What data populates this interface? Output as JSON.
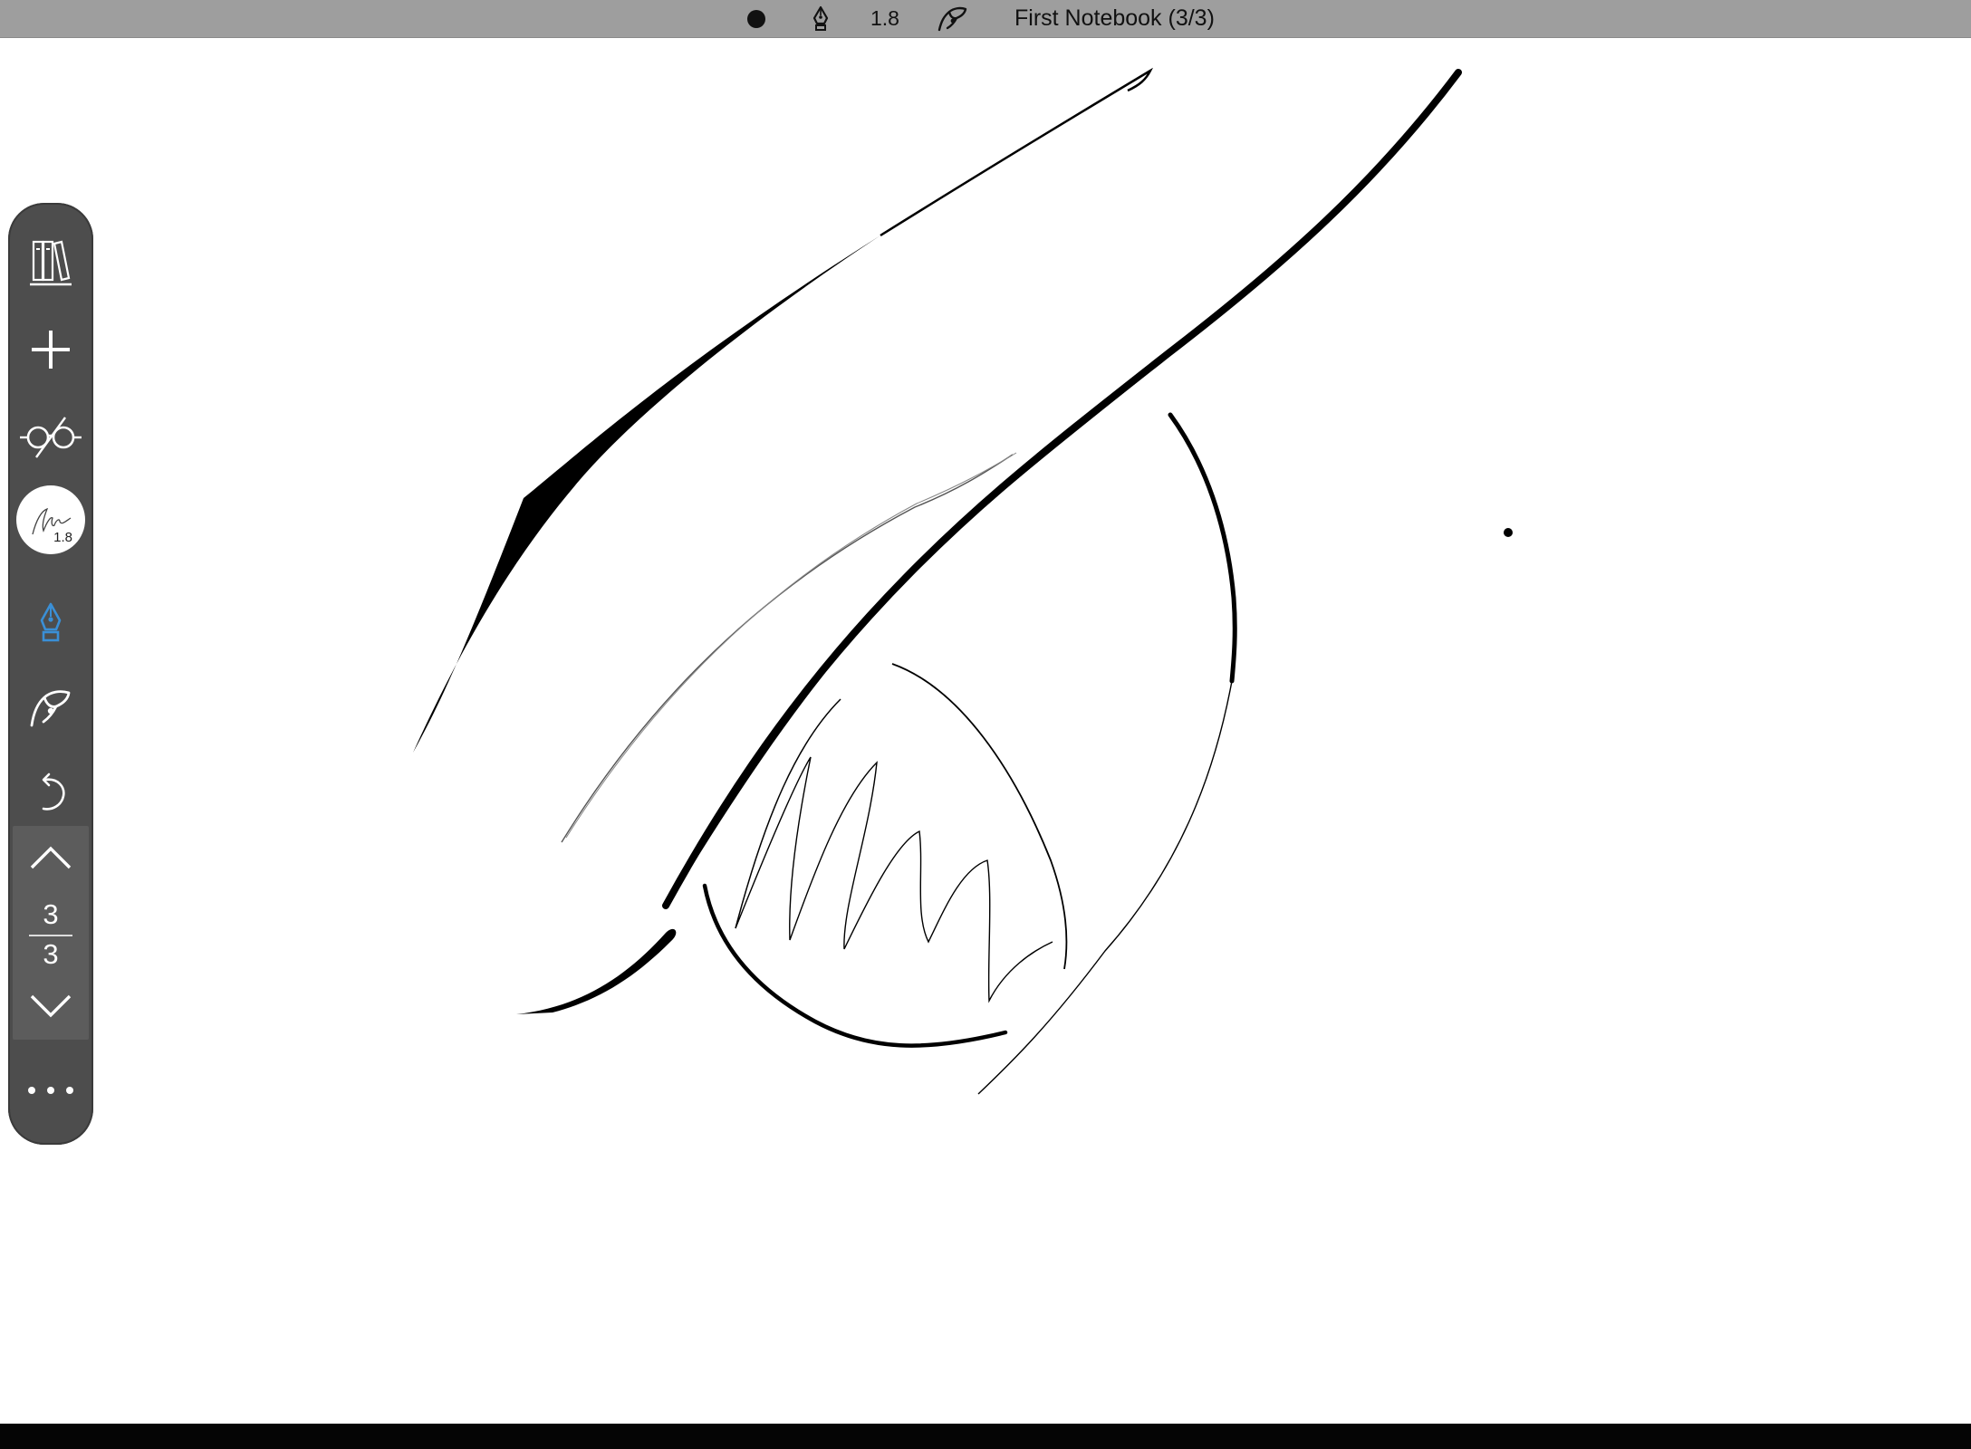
{
  "topbar": {
    "color_icon": "filled-circle-icon",
    "pen_icon": "fountain-pen-icon",
    "pen_size": "1.8",
    "palm_icon": "palm-rejection-icon",
    "title": "First Notebook (3/3)"
  },
  "toolbar": {
    "library_icon": "books-icon",
    "add_icon": "plus-icon",
    "view_icon": "glasses-icon",
    "brush_size": "1.8",
    "pen_icon": "fountain-pen-icon",
    "palm_icon": "palm-rejection-icon",
    "undo_icon": "undo-icon",
    "page_current": "3",
    "page_total": "3",
    "more_icon": "more-dots-icon",
    "active_color": "#3a8fd6"
  }
}
